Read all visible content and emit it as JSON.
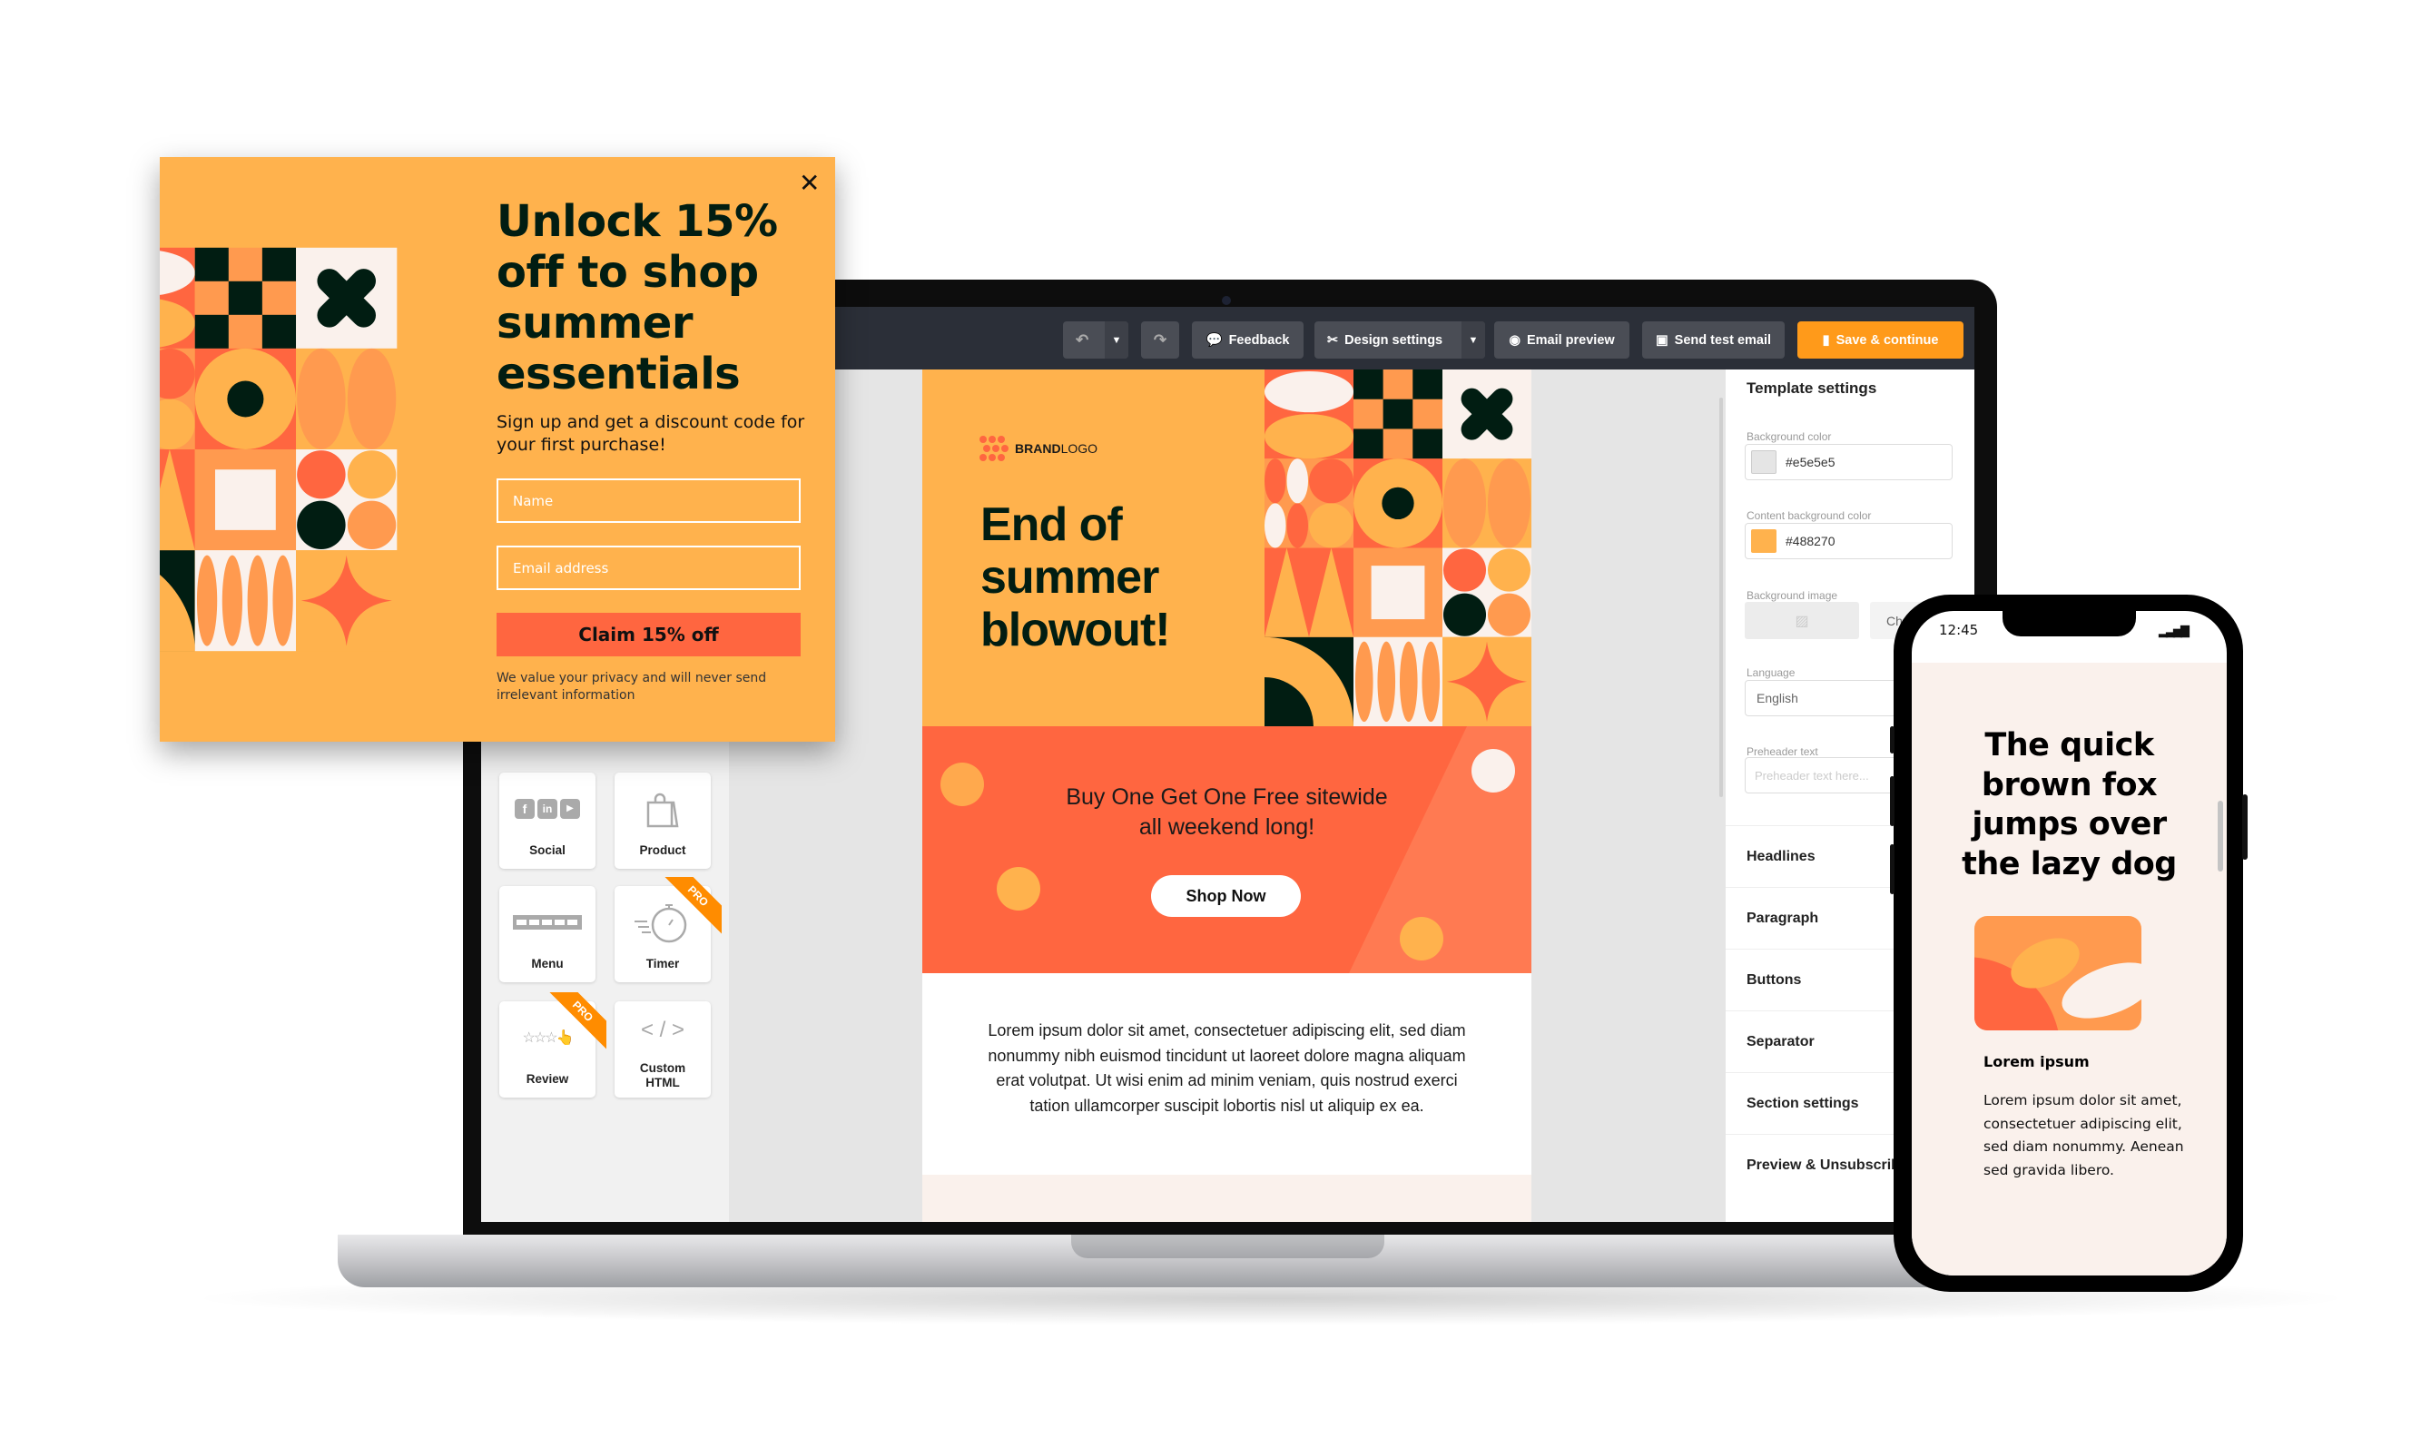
{
  "colors": {
    "orange": "#ffb24d",
    "coral": "#ff6640",
    "dark_green": "#011d12",
    "cream": "#faf1ec",
    "save_orange": "#ff9a1a"
  },
  "popup": {
    "title": "Unlock 15% off to shop summer essentials",
    "subtitle": "Sign up and get a discount code for your first purchase!",
    "name_placeholder": "Name",
    "email_placeholder": "Email address",
    "claim_label": "Claim 15% off",
    "privacy": "We value your privacy and will never send irrelevant information",
    "close_icon": "close-icon"
  },
  "toolbar": {
    "undo_icon": "undo-icon",
    "redo_icon": "redo-icon",
    "feedback": "Feedback",
    "design_settings": "Design settings",
    "email_preview": "Email preview",
    "send_test": "Send test email",
    "save": "Save & continue"
  },
  "blocks": [
    {
      "label": "Social",
      "icon": "social-icons",
      "pro": false
    },
    {
      "label": "Product",
      "icon": "shopping-bag-icon",
      "pro": false
    },
    {
      "label": "Menu",
      "icon": "menu-bar-icon",
      "pro": false
    },
    {
      "label": "Timer",
      "icon": "stopwatch-icon",
      "pro": true
    },
    {
      "label": "Review",
      "icon": "star-rating-icon",
      "pro": true
    },
    {
      "label": "Custom HTML",
      "icon": "code-icon",
      "pro": false
    }
  ],
  "pro_badge": "PRO",
  "email": {
    "brand_bold": "BRAND",
    "brand_light": "LOGO",
    "hero_title": "End of summer blowout!",
    "promo_line1": "Buy One Get One Free sitewide",
    "promo_line2": "all weekend long!",
    "cta": "Shop Now",
    "body": "Lorem ipsum dolor sit amet, consectetuer adipiscing elit, sed diam nonummy nibh euismod tincidunt ut laoreet dolore magna aliquam erat volutpat. Ut wisi enim ad minim veniam, quis nostrud exerci tation ullamcorper suscipit lobortis nisl ut aliquip ex ea."
  },
  "settings": {
    "title": "Template settings",
    "bg_color_label": "Background color",
    "bg_color_value": "#e5e5e5",
    "content_bg_label": "Content background color",
    "content_bg_value": "#488270",
    "bg_image_label": "Background image",
    "bg_image_button": "Ch",
    "language_label": "Language",
    "language_value": "English",
    "preheader_label": "Preheader text",
    "preheader_placeholder": "Preheader text here...",
    "sections": [
      "Headlines",
      "Paragraph",
      "Buttons",
      "Separator",
      "Section settings",
      "Preview & Unsubscribe"
    ]
  },
  "phone": {
    "time": "12:45",
    "title": "The quick brown fox jumps over the lazy dog",
    "heading": "Lorem ipsum",
    "body": "Lorem ipsum dolor sit amet, consectetuer adipiscing elit, sed diam nonummy. Aenean sed gravida libero."
  }
}
